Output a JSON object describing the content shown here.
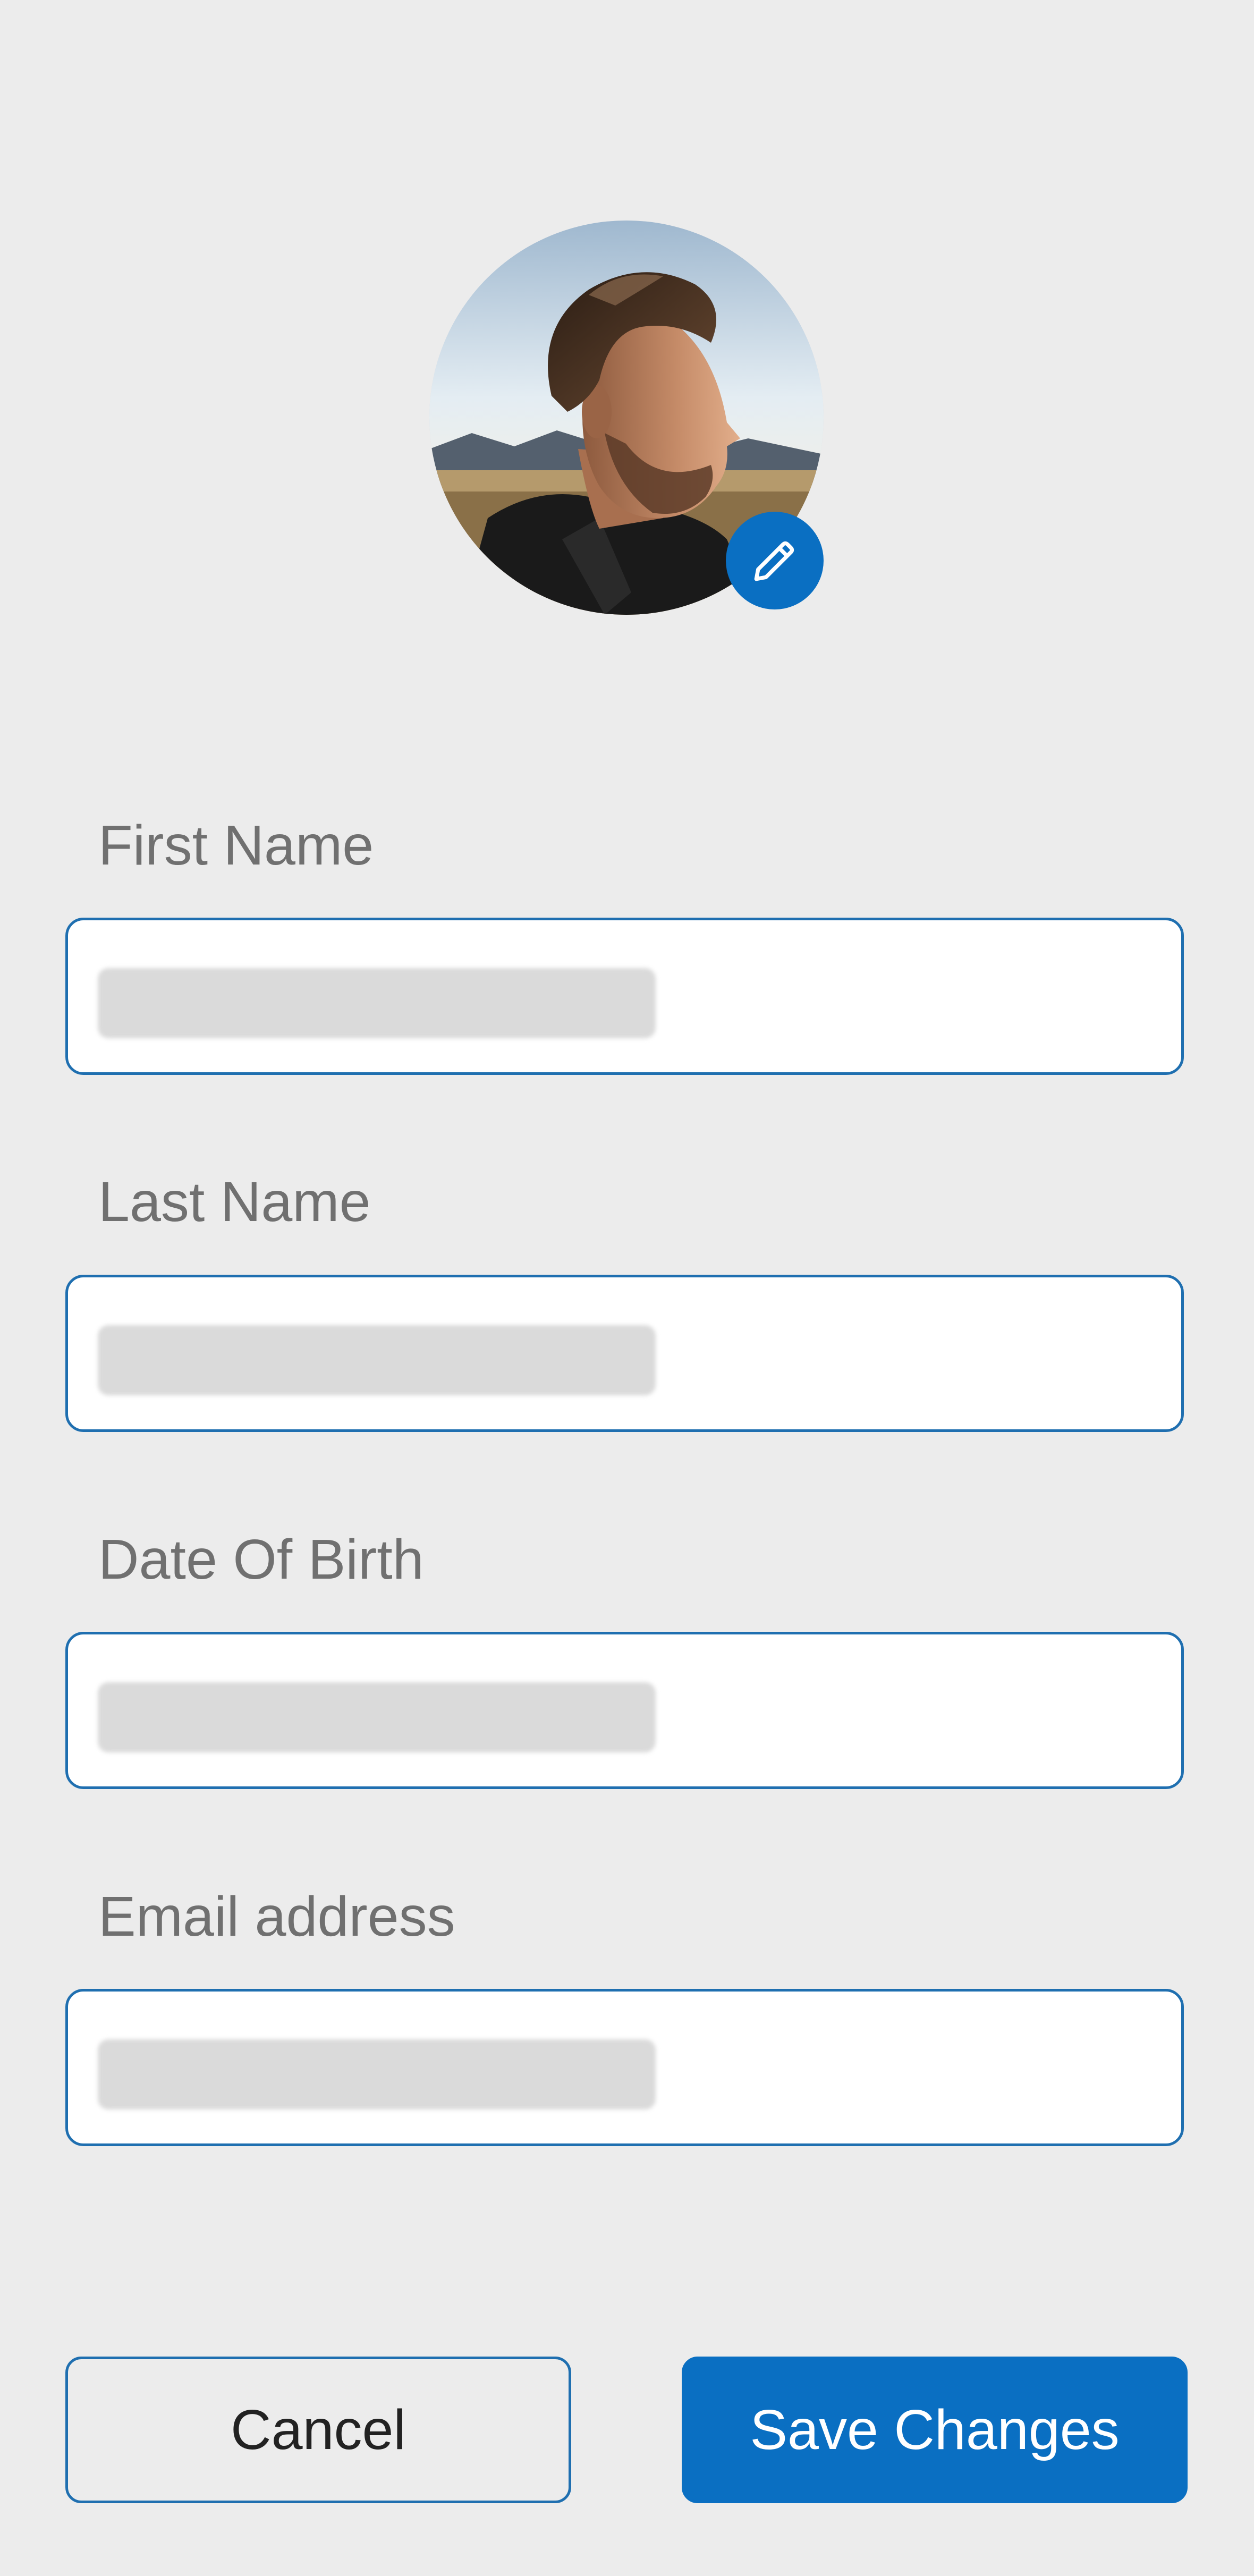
{
  "profile": {
    "avatar_alt": "Profile photo",
    "edit_icon": "pencil-icon"
  },
  "form": {
    "first_name": {
      "label": "First Name",
      "value": ""
    },
    "last_name": {
      "label": "Last Name",
      "value": ""
    },
    "dob": {
      "label": "Date Of Birth",
      "value": ""
    },
    "email": {
      "label": "Email address",
      "value": ""
    }
  },
  "actions": {
    "cancel_label": "Cancel",
    "save_label": "Save Changes"
  },
  "colors": {
    "background": "#ececec",
    "accent": "#0a6fc2",
    "field_border": "#1f6fb0",
    "label_text": "#707070"
  }
}
